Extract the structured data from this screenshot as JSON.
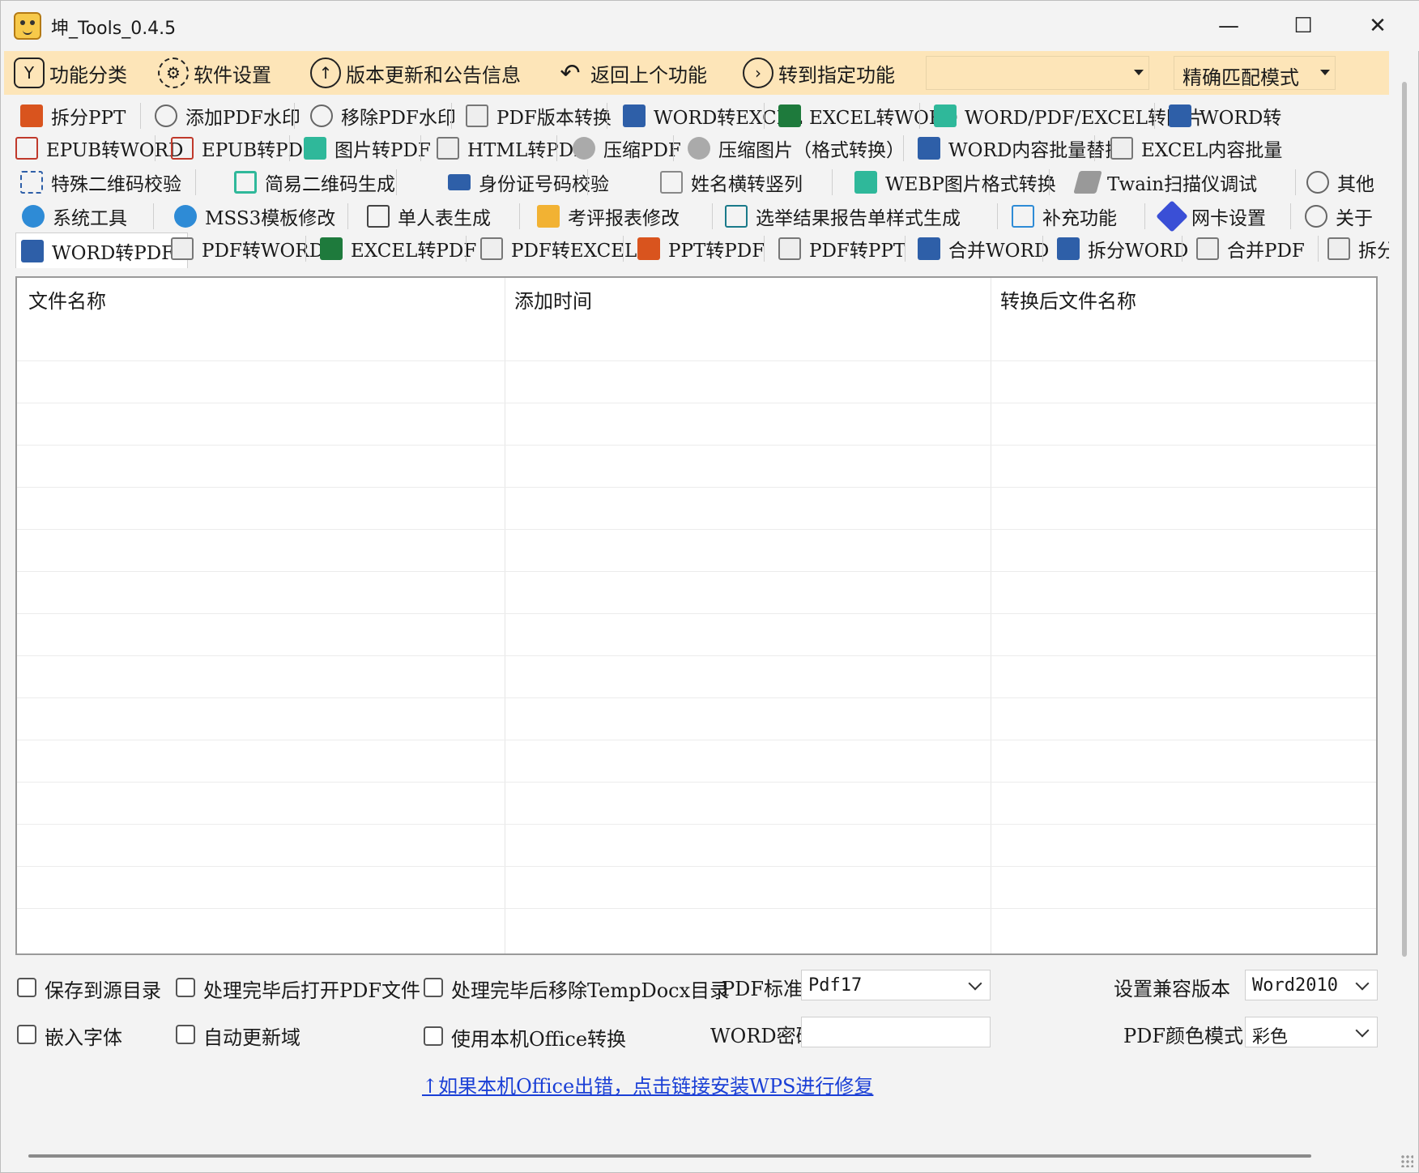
{
  "window": {
    "title": "坤_Tools_0.4.5",
    "minimize": "—",
    "maximize": "☐",
    "close": "✕"
  },
  "toolbar": {
    "categories": "功能分类",
    "settings": "软件设置",
    "updates": "版本更新和公告信息",
    "back": "返回上个功能",
    "goto": "转到指定功能",
    "search_value": "",
    "match_mode": "精确匹配模式"
  },
  "rows": {
    "r1": [
      "拆分PPT",
      "添加PDF水印",
      "移除PDF水印",
      "PDF版本转换",
      "WORD转EXCEL",
      "EXCEL转WORD",
      "WORD/PDF/EXCEL转图片",
      "WORD转"
    ],
    "r2": [
      "EPUB转WORD",
      "EPUB转PDF",
      "图片转PDF",
      "HTML转PDF",
      "压缩PDF",
      "压缩图片（格式转换）",
      "WORD内容批量替换",
      "EXCEL内容批量"
    ],
    "r3": [
      "特殊二维码校验",
      "简易二维码生成",
      "身份证号码校验",
      "姓名横转竖列",
      "WEBP图片格式转换",
      "Twain扫描仪调试",
      "其他"
    ],
    "r4": [
      "系统工具",
      "MSS3模板修改",
      "单人表生成",
      "考评报表修改",
      "选举结果报告单样式生成",
      "补充功能",
      "网卡设置",
      "关于"
    ],
    "r5": [
      "WORD转PDF",
      "PDF转WORD",
      "EXCEL转PDF",
      "PDF转EXCEL",
      "PPT转PDF",
      "PDF转PPT",
      "合并WORD",
      "拆分WORD",
      "合并PDF",
      "拆分"
    ]
  },
  "table": {
    "columns": [
      "文件名称",
      "添加时间",
      "转换后文件名称"
    ]
  },
  "options": {
    "save_source": "保存到源目录",
    "open_after": "处理完毕后打开PDF文件",
    "remove_temp": "处理完毕后移除TempDocx目录",
    "embed_fonts": "嵌入字体",
    "auto_update": "自动更新域",
    "use_office": "使用本机Office转换",
    "pdf_std_label": "PDF标准",
    "pdf_std_value": "Pdf17",
    "word_pwd_label": "WORD密码",
    "word_pwd_value": "",
    "compat_label": "设置兼容版本",
    "compat_value": "Word2010",
    "color_label": "PDF颜色模式",
    "color_value": "彩色"
  },
  "link": "↑如果本机Office出错，点击链接安装WPS进行修复",
  "colors": {
    "toolbar_bg": "#fde5b8",
    "link": "#1a3fd6"
  }
}
